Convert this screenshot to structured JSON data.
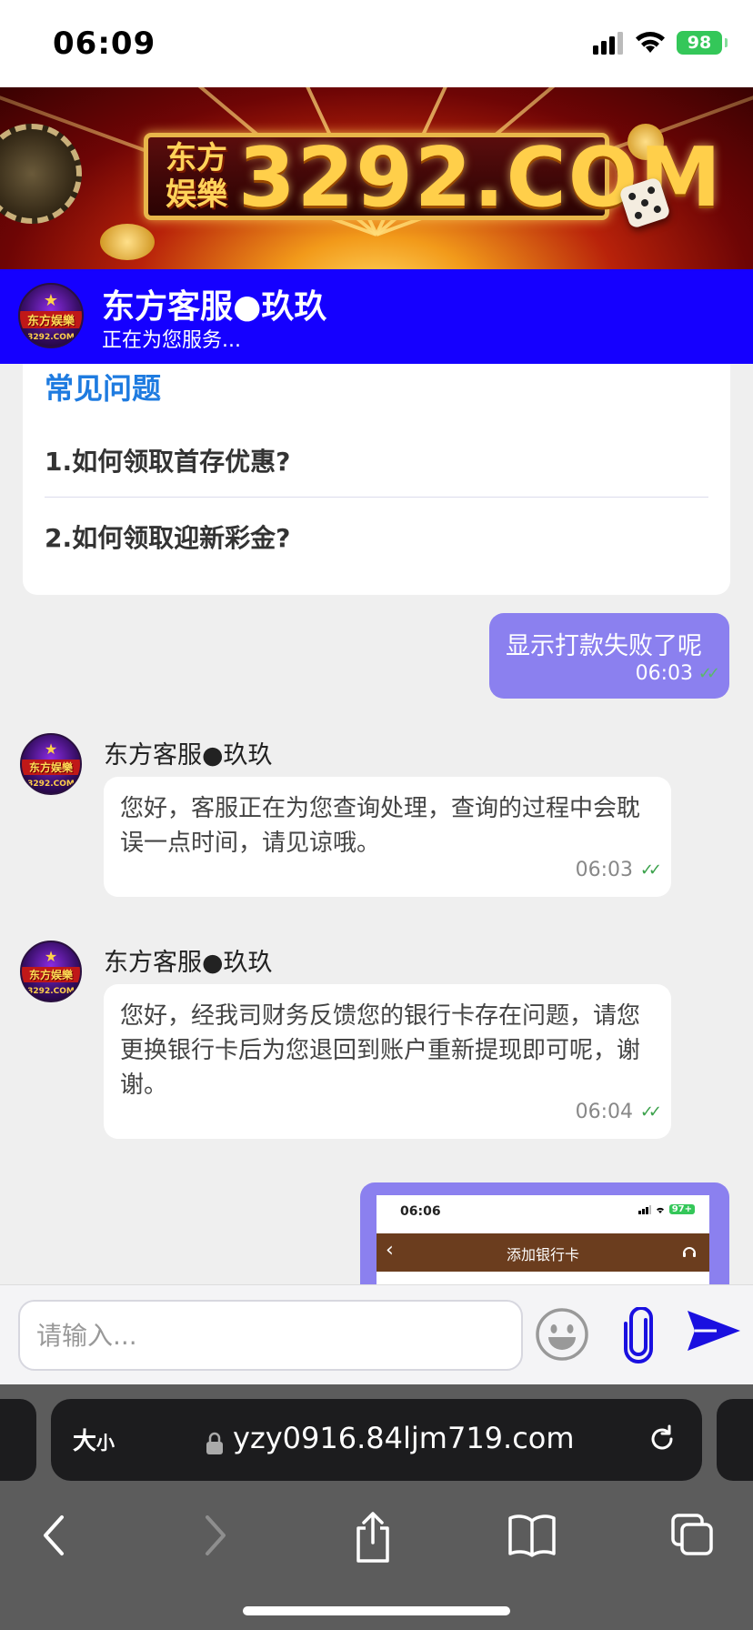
{
  "status_bar": {
    "time": "06:09",
    "battery": "98"
  },
  "banner": {
    "cn_text": "东方娱樂",
    "domain_text": "3292.COM"
  },
  "header": {
    "name": "东方客服●玖玖",
    "status": "正在为您服务..."
  },
  "avatar": {
    "text": "东方娱樂",
    "sub": "3292.COM"
  },
  "faq": {
    "title": "常见问题",
    "items": [
      "1.如何领取首存优惠?",
      "2.如何领取迎新彩金?"
    ]
  },
  "messages": [
    {
      "side": "out",
      "text": "显示打款失败了呢",
      "time": "06:03"
    },
    {
      "side": "in",
      "sender": "东方客服●玖玖",
      "text": "您好，客服正在为您查询处理，查询的过程中会耽误一点时间，请见谅哦。",
      "time": "06:03"
    },
    {
      "side": "in",
      "sender": "东方客服●玖玖",
      "text": "您好，经我司财务反馈您的银行卡存在问题，请您更换银行卡后为您退回到账户重新提现即可呢，谢谢。",
      "time": "06:04"
    }
  ],
  "image_message": {
    "time": "06:06",
    "battery": "97+",
    "title": "添加银行卡"
  },
  "input": {
    "placeholder": "请输入..."
  },
  "browser": {
    "text_size_label": "大",
    "text_size_small": "小",
    "url": "yzy0916.84ljm719.com"
  }
}
